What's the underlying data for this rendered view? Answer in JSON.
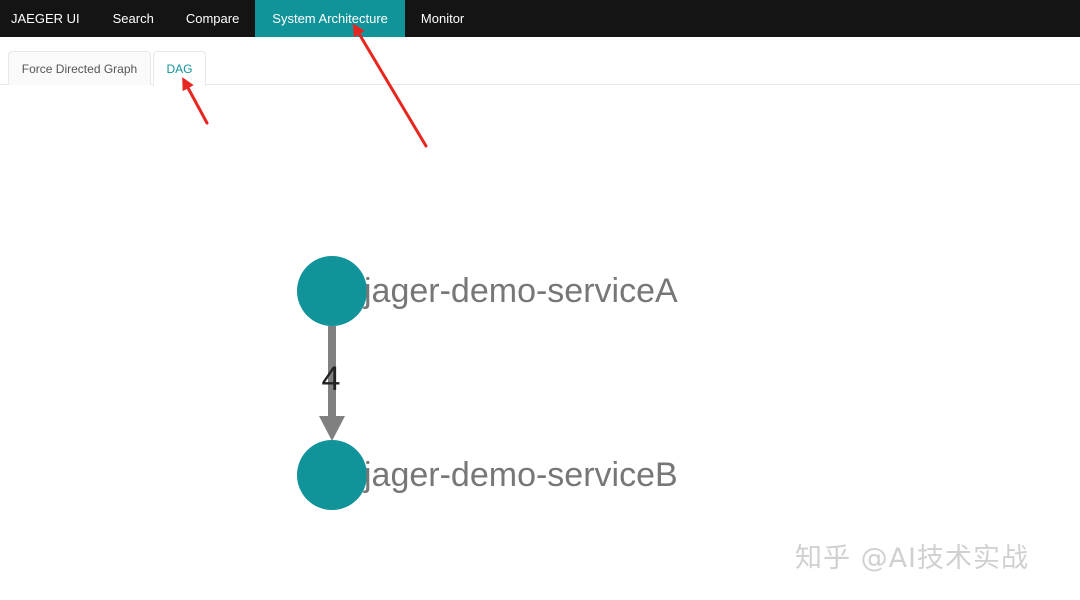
{
  "nav": {
    "brand": "JAEGER UI",
    "items": [
      {
        "label": "Search"
      },
      {
        "label": "Compare"
      },
      {
        "label": "System Architecture",
        "active": true
      },
      {
        "label": "Monitor"
      }
    ]
  },
  "tabs": [
    {
      "label": "Force Directed Graph"
    },
    {
      "label": "DAG",
      "active": true
    }
  ],
  "dag": {
    "nodes": [
      {
        "label": "jager-demo-serviceA"
      },
      {
        "label": "jager-demo-serviceB"
      }
    ],
    "edge": {
      "count": "4"
    }
  },
  "watermark": "知乎 @AI技术实战",
  "colors": {
    "nav_bg": "#141414",
    "accent": "#11939a",
    "node": "#11939a",
    "edge": "#808080",
    "annotation_arrow": "#e8261f"
  },
  "icons": [
    "annotation-arrow-icon"
  ]
}
